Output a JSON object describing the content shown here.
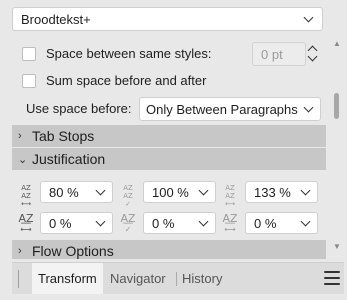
{
  "style_select": {
    "value": "Broodtekst+"
  },
  "spacing": {
    "between_same_styles_label": "Space between same styles:",
    "between_same_styles_value": "0 pt",
    "sum_space_label": "Sum space before and after",
    "use_space_before_label": "Use space before:",
    "use_space_before_value": "Only Between Paragraphs"
  },
  "sections": {
    "tab_stops": "Tab Stops",
    "justification": "Justification",
    "flow_options": "Flow Options"
  },
  "justification": {
    "row1": [
      "80 %",
      "100 %",
      "133 %"
    ],
    "row2": [
      "0 %",
      "0 %",
      "0 %"
    ]
  },
  "icons": {
    "section_collapsed": "›",
    "section_expanded": "⌄"
  },
  "tabs": {
    "transform": "Transform",
    "navigator": "Navigator",
    "history": "History"
  }
}
